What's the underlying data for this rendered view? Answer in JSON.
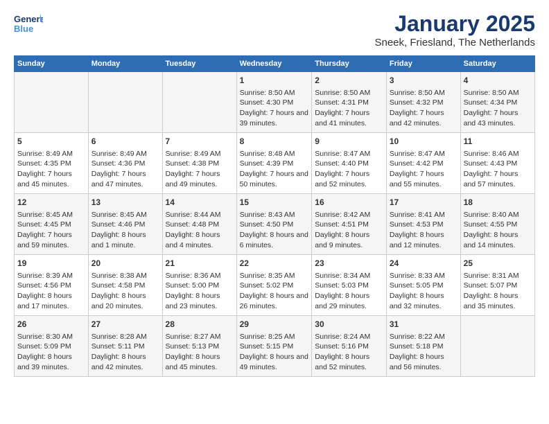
{
  "header": {
    "logo_line1": "General",
    "logo_line2": "Blue",
    "month": "January 2025",
    "location": "Sneek, Friesland, The Netherlands"
  },
  "days_of_week": [
    "Sunday",
    "Monday",
    "Tuesday",
    "Wednesday",
    "Thursday",
    "Friday",
    "Saturday"
  ],
  "weeks": [
    [
      {
        "day": "",
        "data": ""
      },
      {
        "day": "",
        "data": ""
      },
      {
        "day": "",
        "data": ""
      },
      {
        "day": "1",
        "data": "Sunrise: 8:50 AM\nSunset: 4:30 PM\nDaylight: 7 hours and 39 minutes."
      },
      {
        "day": "2",
        "data": "Sunrise: 8:50 AM\nSunset: 4:31 PM\nDaylight: 7 hours and 41 minutes."
      },
      {
        "day": "3",
        "data": "Sunrise: 8:50 AM\nSunset: 4:32 PM\nDaylight: 7 hours and 42 minutes."
      },
      {
        "day": "4",
        "data": "Sunrise: 8:50 AM\nSunset: 4:34 PM\nDaylight: 7 hours and 43 minutes."
      }
    ],
    [
      {
        "day": "5",
        "data": "Sunrise: 8:49 AM\nSunset: 4:35 PM\nDaylight: 7 hours and 45 minutes."
      },
      {
        "day": "6",
        "data": "Sunrise: 8:49 AM\nSunset: 4:36 PM\nDaylight: 7 hours and 47 minutes."
      },
      {
        "day": "7",
        "data": "Sunrise: 8:49 AM\nSunset: 4:38 PM\nDaylight: 7 hours and 49 minutes."
      },
      {
        "day": "8",
        "data": "Sunrise: 8:48 AM\nSunset: 4:39 PM\nDaylight: 7 hours and 50 minutes."
      },
      {
        "day": "9",
        "data": "Sunrise: 8:47 AM\nSunset: 4:40 PM\nDaylight: 7 hours and 52 minutes."
      },
      {
        "day": "10",
        "data": "Sunrise: 8:47 AM\nSunset: 4:42 PM\nDaylight: 7 hours and 55 minutes."
      },
      {
        "day": "11",
        "data": "Sunrise: 8:46 AM\nSunset: 4:43 PM\nDaylight: 7 hours and 57 minutes."
      }
    ],
    [
      {
        "day": "12",
        "data": "Sunrise: 8:45 AM\nSunset: 4:45 PM\nDaylight: 7 hours and 59 minutes."
      },
      {
        "day": "13",
        "data": "Sunrise: 8:45 AM\nSunset: 4:46 PM\nDaylight: 8 hours and 1 minute."
      },
      {
        "day": "14",
        "data": "Sunrise: 8:44 AM\nSunset: 4:48 PM\nDaylight: 8 hours and 4 minutes."
      },
      {
        "day": "15",
        "data": "Sunrise: 8:43 AM\nSunset: 4:50 PM\nDaylight: 8 hours and 6 minutes."
      },
      {
        "day": "16",
        "data": "Sunrise: 8:42 AM\nSunset: 4:51 PM\nDaylight: 8 hours and 9 minutes."
      },
      {
        "day": "17",
        "data": "Sunrise: 8:41 AM\nSunset: 4:53 PM\nDaylight: 8 hours and 12 minutes."
      },
      {
        "day": "18",
        "data": "Sunrise: 8:40 AM\nSunset: 4:55 PM\nDaylight: 8 hours and 14 minutes."
      }
    ],
    [
      {
        "day": "19",
        "data": "Sunrise: 8:39 AM\nSunset: 4:56 PM\nDaylight: 8 hours and 17 minutes."
      },
      {
        "day": "20",
        "data": "Sunrise: 8:38 AM\nSunset: 4:58 PM\nDaylight: 8 hours and 20 minutes."
      },
      {
        "day": "21",
        "data": "Sunrise: 8:36 AM\nSunset: 5:00 PM\nDaylight: 8 hours and 23 minutes."
      },
      {
        "day": "22",
        "data": "Sunrise: 8:35 AM\nSunset: 5:02 PM\nDaylight: 8 hours and 26 minutes."
      },
      {
        "day": "23",
        "data": "Sunrise: 8:34 AM\nSunset: 5:03 PM\nDaylight: 8 hours and 29 minutes."
      },
      {
        "day": "24",
        "data": "Sunrise: 8:33 AM\nSunset: 5:05 PM\nDaylight: 8 hours and 32 minutes."
      },
      {
        "day": "25",
        "data": "Sunrise: 8:31 AM\nSunset: 5:07 PM\nDaylight: 8 hours and 35 minutes."
      }
    ],
    [
      {
        "day": "26",
        "data": "Sunrise: 8:30 AM\nSunset: 5:09 PM\nDaylight: 8 hours and 39 minutes."
      },
      {
        "day": "27",
        "data": "Sunrise: 8:28 AM\nSunset: 5:11 PM\nDaylight: 8 hours and 42 minutes."
      },
      {
        "day": "28",
        "data": "Sunrise: 8:27 AM\nSunset: 5:13 PM\nDaylight: 8 hours and 45 minutes."
      },
      {
        "day": "29",
        "data": "Sunrise: 8:25 AM\nSunset: 5:15 PM\nDaylight: 8 hours and 49 minutes."
      },
      {
        "day": "30",
        "data": "Sunrise: 8:24 AM\nSunset: 5:16 PM\nDaylight: 8 hours and 52 minutes."
      },
      {
        "day": "31",
        "data": "Sunrise: 8:22 AM\nSunset: 5:18 PM\nDaylight: 8 hours and 56 minutes."
      },
      {
        "day": "",
        "data": ""
      }
    ]
  ]
}
